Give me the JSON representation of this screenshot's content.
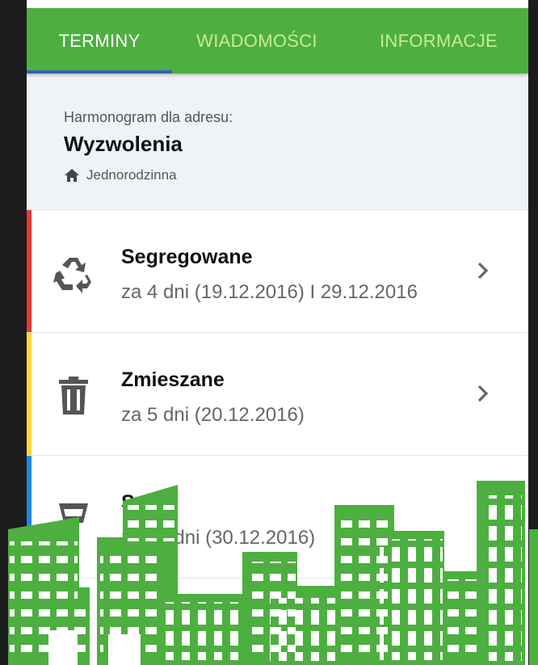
{
  "tabs": [
    {
      "label": "TERMINY",
      "active": true
    },
    {
      "label": "WIADOMOŚCI",
      "active": false
    },
    {
      "label": "INFORMACJE",
      "active": false
    }
  ],
  "header": {
    "caption": "Harmonogram dla adresu:",
    "street": "Wyzwolenia",
    "building_type": "Jednorodzinna",
    "building_icon": "home-icon"
  },
  "schedule": [
    {
      "name": "Segregowane",
      "dates": "za 4 dni (19.12.2016)  I  29.12.2016",
      "stripe_color": "#e53935",
      "icon": "recycle-icon"
    },
    {
      "name": "Zmieszane",
      "dates": "za 5 dni (20.12.2016)",
      "stripe_color": "#fdd835",
      "icon": "trash-icon"
    },
    {
      "name": "S",
      "dates": "za 15 dni (30.12.2016)",
      "stripe_color": "#1e88e5",
      "icon": "glass-bin-icon"
    }
  ],
  "colors": {
    "brand_green": "#4daf3f",
    "tab_inactive": "#c8eb97",
    "tab_indicator": "#2d64b8",
    "header_bg": "#f0f3f6"
  }
}
